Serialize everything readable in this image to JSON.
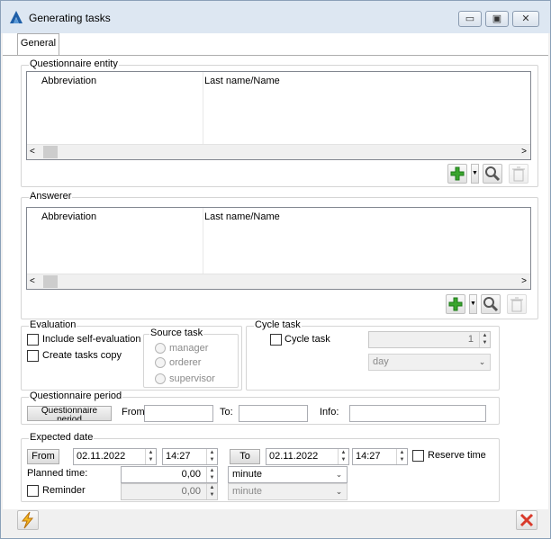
{
  "window": {
    "title": "Generating tasks",
    "minimize": "▭",
    "restore": "▣",
    "close": "✕"
  },
  "tabs": [
    {
      "label": "General"
    }
  ],
  "questionnaire_entity": {
    "legend": "Questionnaire entity",
    "columns": [
      "Abbreviation",
      "Last name/Name"
    ]
  },
  "answerer": {
    "legend": "Answerer",
    "columns": [
      "Abbreviation",
      "Last name/Name"
    ]
  },
  "evaluation": {
    "legend": "Evaluation",
    "include_self": "Include self-evaluation",
    "create_copy": "Create tasks copy",
    "source_task": {
      "legend": "Source task",
      "options": [
        "manager",
        "orderer",
        "supervisor"
      ]
    }
  },
  "cycle_task": {
    "legend": "Cycle task",
    "checkbox": "Cycle task",
    "count": "1",
    "unit": "day"
  },
  "questionnaire_period": {
    "legend": "Questionnaire period",
    "button": "Questionnaire period",
    "from_label": "From",
    "to_label": "To:",
    "info_label": "Info:"
  },
  "expected_date": {
    "legend": "Expected date",
    "from_button": "From",
    "from_date": "02.11.2022",
    "from_time": "14:27",
    "to_button": "To",
    "to_date": "02.11.2022",
    "to_time": "14:27",
    "reserve_time": "Reserve time",
    "planned_label": "Planned time:",
    "planned_value": "0,00",
    "planned_unit": "minute",
    "reminder_label": "Reminder",
    "reminder_value": "0,00",
    "reminder_unit": "minute"
  },
  "colors": {
    "add": "#3aa52e",
    "titlebar": "#dde7f2",
    "close_red": "#d93a2b"
  }
}
